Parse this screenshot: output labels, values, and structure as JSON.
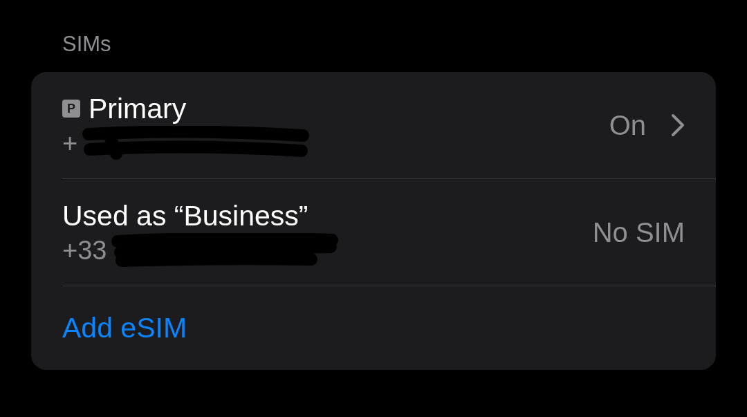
{
  "section_header": "SIMs",
  "sims": [
    {
      "badge": "P",
      "name": "Primary",
      "number": "+",
      "status": "On",
      "chevron": true
    },
    {
      "name": "Used as “Business”",
      "number": "+33",
      "status": "No SIM",
      "chevron": false
    }
  ],
  "add_esim": "Add eSIM"
}
